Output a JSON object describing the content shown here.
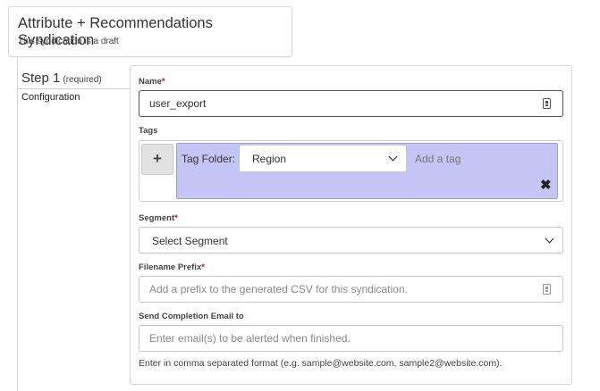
{
  "header": {
    "title": "Attribute + Recommendations Syndication",
    "subtitle": "This syndication is a draft"
  },
  "step": {
    "title": "Step 1",
    "required_note": "(required)",
    "section": "Configuration"
  },
  "form": {
    "name": {
      "label": "Name",
      "required_mark": "*",
      "value": "user_export"
    },
    "tags": {
      "label": "Tags",
      "add_button": "+",
      "tag_folder_label": "Tag Folder:",
      "tag_folder_value": "Region",
      "add_tag_placeholder": "Add a tag",
      "remove_glyph": "✖"
    },
    "segment": {
      "label": "Segment",
      "required_mark": "*",
      "value": "Select Segment"
    },
    "filename_prefix": {
      "label": "Filename Prefix",
      "required_mark": "*",
      "placeholder": "Add a prefix to the generated CSV for this syndication."
    },
    "completion_email": {
      "label": "Send Completion Email to",
      "placeholder": "Enter email(s) to be alerted when finished.",
      "hint": "Enter in comma separated format (e.g. sample@website.com, sample2@website.com)."
    }
  },
  "icons": {
    "name_field": "password-manager-icon",
    "prefix_field": "password-manager-icon",
    "dropdown": "chevron-down-icon",
    "remove": "close-icon"
  }
}
